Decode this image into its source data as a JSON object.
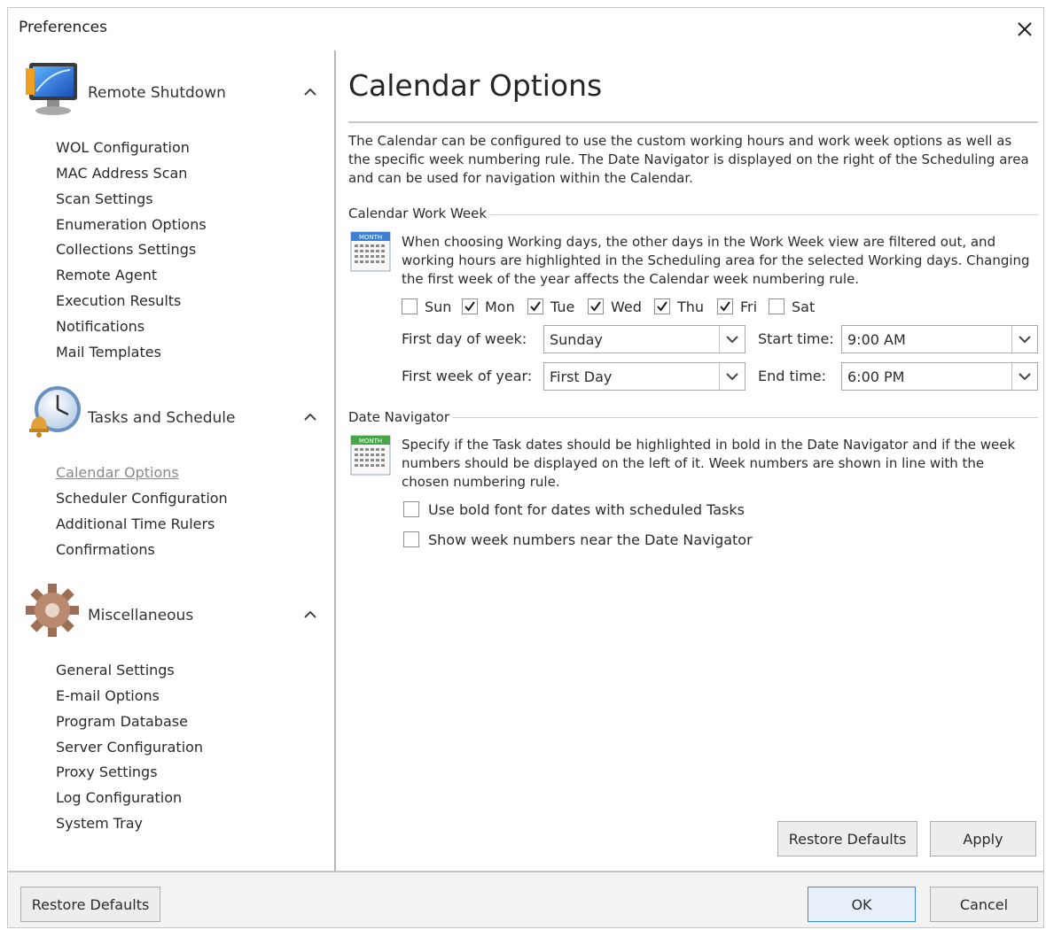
{
  "window": {
    "title": "Preferences"
  },
  "sidebar": {
    "groups": [
      {
        "title": "Remote Shutdown",
        "icon": "monitor-icon",
        "items": [
          "WOL Configuration",
          "MAC Address Scan",
          "Scan Settings",
          "Enumeration Options",
          "Collections Settings",
          "Remote Agent",
          "Execution Results",
          "Notifications",
          "Mail Templates"
        ]
      },
      {
        "title": "Tasks and Schedule",
        "icon": "clock-icon",
        "items": [
          "Calendar Options",
          "Scheduler Configuration",
          "Additional Time Rulers",
          "Confirmations"
        ]
      },
      {
        "title": "Miscellaneous",
        "icon": "gear-icon",
        "items": [
          "General Settings",
          "E-mail Options",
          "Program Database",
          "Server Configuration",
          "Proxy Settings",
          "Log Configuration",
          "System Tray"
        ]
      }
    ],
    "active_item": "Calendar Options"
  },
  "main": {
    "title": "Calendar Options",
    "intro": "The Calendar can be configured to use the custom working hours and work week options as well as the specific week numbering rule. The Date Navigator is displayed on the right of the Scheduling area and can be used for navigation within the Calendar.",
    "work_week": {
      "label": "Calendar Work Week",
      "icon_caption": "MONTH",
      "description": "When choosing Working days, the other days in the Work Week view are filtered out, and working hours are highlighted in the Scheduling area for the selected Working days. Changing the first week of the year affects the Calendar week numbering rule.",
      "days": [
        {
          "label": "Sun",
          "checked": false
        },
        {
          "label": "Mon",
          "checked": true
        },
        {
          "label": "Tue",
          "checked": true
        },
        {
          "label": "Wed",
          "checked": true
        },
        {
          "label": "Thu",
          "checked": true
        },
        {
          "label": "Fri",
          "checked": true
        },
        {
          "label": "Sat",
          "checked": false
        }
      ],
      "first_day_label": "First day of week:",
      "first_day_value": "Sunday",
      "first_week_label": "First week of year:",
      "first_week_value": "First Day",
      "start_time_label": "Start time:",
      "start_time_value": "9:00 AM",
      "end_time_label": "End time:",
      "end_time_value": "6:00 PM"
    },
    "date_navigator": {
      "label": "Date Navigator",
      "icon_caption": "MONTH",
      "description": "Specify if the Task dates should be highlighted in bold in the Date Navigator and if the week numbers should be displayed on the left of it. Week numbers are shown in line with the chosen numbering rule.",
      "options": [
        {
          "label": "Use bold font for dates with scheduled Tasks",
          "checked": false
        },
        {
          "label": "Show week numbers near the Date Navigator",
          "checked": false
        }
      ]
    },
    "buttons": {
      "restore": "Restore Defaults",
      "apply": "Apply"
    }
  },
  "footer": {
    "restore": "Restore Defaults",
    "ok": "OK",
    "cancel": "Cancel"
  },
  "colors": {
    "accent_border": "#3b8ad6",
    "calendar_blue": "#3f7fd0",
    "calendar_green": "#47a447"
  }
}
